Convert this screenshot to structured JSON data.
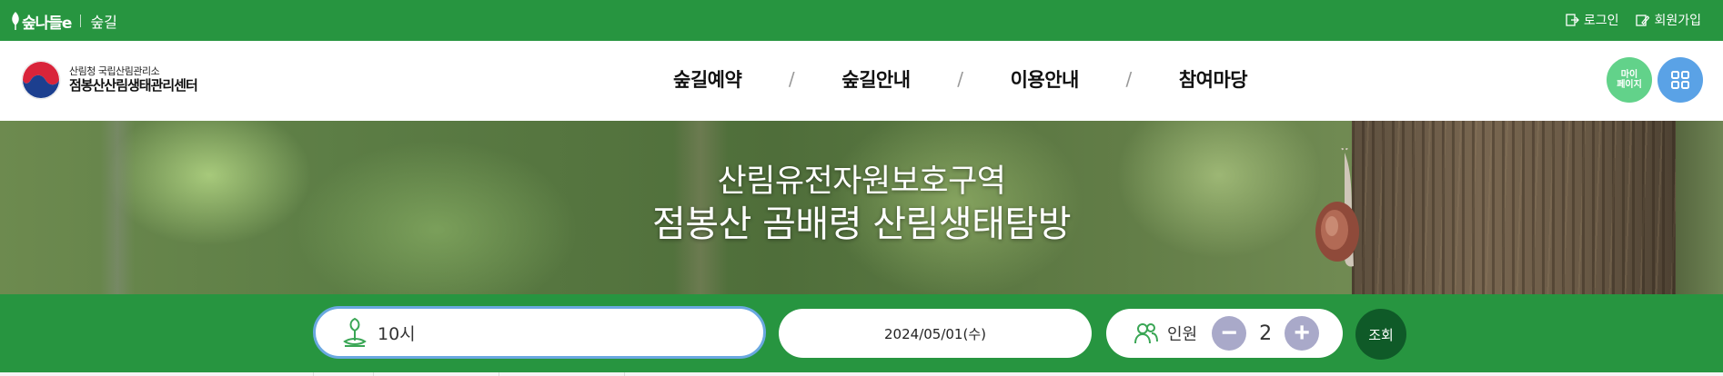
{
  "topbar": {
    "brand_logo_text": "숲나들e",
    "site_name": "숲길",
    "login_label": "로그인",
    "signup_label": "회원가입"
  },
  "header": {
    "org_ministry": "산림청 국립산림관리소",
    "org_name": "점봉산산림생태관리센터",
    "nav": [
      "숲길예약",
      "숲길안내",
      "이용안내",
      "참여마당"
    ],
    "nav_separator": "/",
    "mypage_label_line1": "마이",
    "mypage_label_line2": "페이지"
  },
  "hero": {
    "subtitle": "산림유전자원보호구역",
    "title": "점봉산 곰배령 산림생태탐방"
  },
  "search": {
    "course_value": "10시",
    "date_value": "2024/05/01(수)",
    "people_label": "인원",
    "minus_label": "−",
    "people_count": "2",
    "plus_label": "+",
    "submit_label": "조회"
  },
  "colors": {
    "brand_green": "#279540",
    "dark_green_button": "#0f5a28",
    "mypage_button": "#62d28a",
    "allmenu_button": "#5aa2e6",
    "stepper_button": "#a9a9c9",
    "focus_border": "#6aa8e0"
  },
  "icons": [
    "leaf-logo-icon",
    "login-icon",
    "signup-icon",
    "government-emblem-icon",
    "grid-menu-icon",
    "trail-marker-icon",
    "people-icon"
  ]
}
